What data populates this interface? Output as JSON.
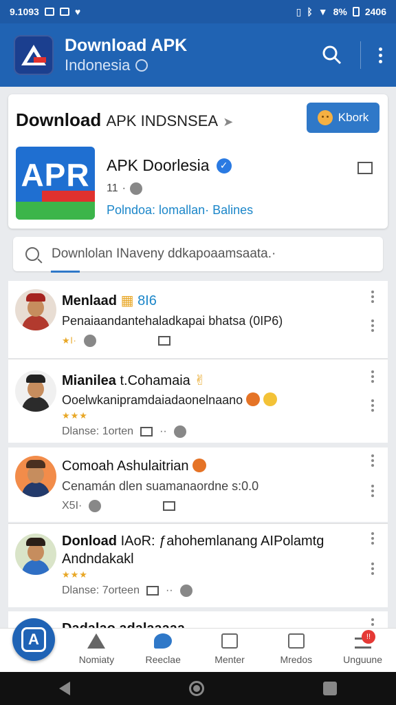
{
  "status_bar": {
    "time": "9.1093",
    "right_text": "8%",
    "clock_right": "2406"
  },
  "app_bar": {
    "title": "Download APK",
    "subtitle": "Indonesia",
    "icons": [
      "search-icon",
      "more-vert-icon"
    ]
  },
  "hero": {
    "title_bold": "Download",
    "title_rest": "APK INDSNSEA",
    "book_label": "Kbork",
    "app_name": "APK Doorlesia",
    "app_icon_text": "APR",
    "app_meta": "11",
    "app_tags": "Polndoa: lomallan· Balines"
  },
  "search": {
    "placeholder": "Downlolan INaveny ddkapoaamsaata.·"
  },
  "feed": [
    {
      "title": "Menlaad",
      "title_extra": "8I6",
      "desc": "Penaiaandantehaladkapai bhatsa (0IP6)",
      "meta": "★l·",
      "colors": {
        "hat": "#a6241f",
        "body": "#b23a2e",
        "bg": "#e8ddd3"
      }
    },
    {
      "title": "Mianilea",
      "title_extra": "t.Cohamaia",
      "desc": "Ooelwkanipramdaiadaonelnaano",
      "stars": "★★★",
      "meta": "Dlanse: 1orten",
      "colors": {
        "hat": "#222222",
        "body": "#2b2b2b",
        "bg": "#f0f0f0"
      }
    },
    {
      "title": "Comoah Ashulaitrian",
      "desc": "Cenamán dlen suamanaordne s:0.0",
      "meta": "X5I·",
      "colors": {
        "hat": "#4a3020",
        "body": "#233a6b",
        "bg": "#f28c4a"
      }
    },
    {
      "title": "Donload",
      "title_extra": "IAoR: ƒahohemlanang AIPolamtg",
      "title_line2": "Andndakakl",
      "stars": "★★★",
      "meta": "Dlanse: 7orteen",
      "colors": {
        "hat": "#2a1f18",
        "body": "#2f6fc4",
        "bg": "#d9e4c8"
      }
    },
    {
      "title": "Dadalao adalaaaaa"
    }
  ],
  "bottom_nav": [
    {
      "label": "Nomiaty",
      "icon": "home-icon"
    },
    {
      "label": "Reeclae",
      "icon": "reels-icon"
    },
    {
      "label": "Menter",
      "icon": "inbox-icon"
    },
    {
      "label": "Mredos",
      "icon": "image-icon"
    },
    {
      "label": "Unguune",
      "icon": "menu-icon",
      "badge": "!!"
    }
  ],
  "colors": {
    "primary": "#2063b3",
    "accent": "#2f78c8",
    "link": "#1b86c9",
    "star": "#e8a726"
  }
}
